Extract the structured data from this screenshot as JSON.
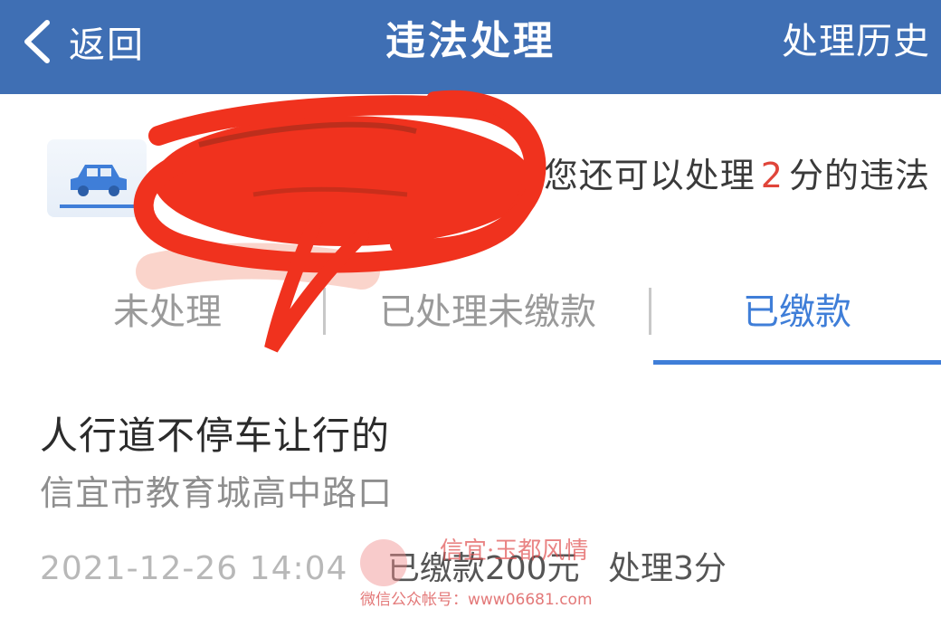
{
  "header": {
    "back_label": "返回",
    "title": "违法处理",
    "history_label": "处理历史",
    "background_color": "#3f6fb4"
  },
  "info": {
    "remaining_prefix": "您还可以处理",
    "remaining_points": "2",
    "remaining_suffix": "分的违法",
    "car_icon": "car-icon"
  },
  "tabs": [
    {
      "label": "未处理",
      "active": false
    },
    {
      "label": "已处理未缴款",
      "active": false
    },
    {
      "label": "已缴款",
      "active": true
    }
  ],
  "record": {
    "title": "人行道不停车让行的",
    "location": "信宜市教育城高中路口",
    "time": "2021-12-26 14:04",
    "status": "已缴款200元",
    "points": "处理3分"
  },
  "watermark": {
    "brand": "信宜·玉都风情",
    "caption": "微信公众帐号：www06681.com"
  },
  "colors": {
    "accent": "#3f7ed8",
    "highlight_number": "#e0453a",
    "redaction": "#f0321e"
  }
}
